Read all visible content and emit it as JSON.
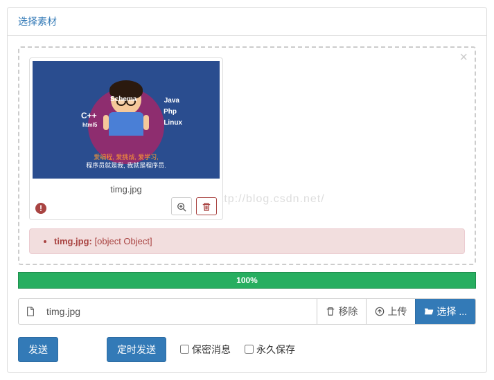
{
  "panel": {
    "title": "选择素材"
  },
  "thumb": {
    "filename": "timg.jpg",
    "image_labels": {
      "schema": "Schema",
      "java": "Java",
      "cpp": "C++",
      "php": "Php",
      "html5": "html5",
      "linux": "Linux"
    },
    "caption_line1": "爱编程, 爱挑战, 爱学习,",
    "caption_line2": "程序员就是我, 我就是程序员."
  },
  "error": {
    "filename": "timg.jpg:",
    "message": "[object Object]"
  },
  "progress": {
    "text": "100%"
  },
  "input": {
    "value": "timg.jpg"
  },
  "buttons": {
    "remove": "移除",
    "upload": "上传",
    "choose": "选择 ...",
    "send": "发送",
    "schedule": "定时发送"
  },
  "checkboxes": {
    "secret": "保密消息",
    "forever": "永久保存"
  },
  "watermark": "http://blog.csdn.net/"
}
